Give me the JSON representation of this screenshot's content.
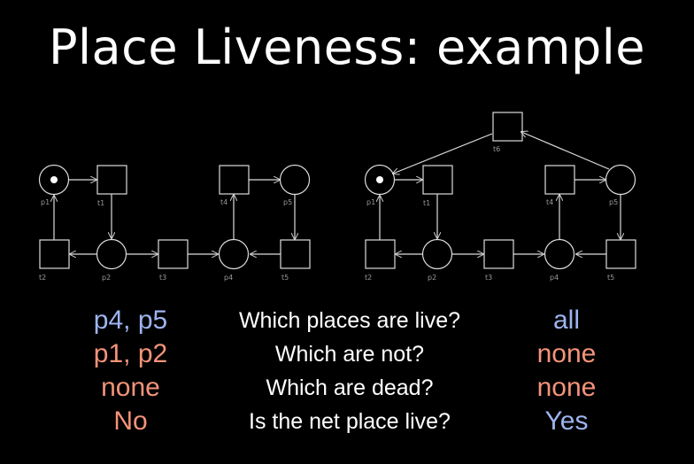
{
  "title": "Place Liveness: example",
  "net_labels": {
    "p1": "p1",
    "p2": "p2",
    "p4": "p4",
    "p5": "p5",
    "t1": "t1",
    "t2": "t2",
    "t3": "t3",
    "t4": "t4",
    "t5": "t5",
    "t6": "t6"
  },
  "left_answers": [
    "p4, p5",
    "p1, p2",
    "none",
    "No"
  ],
  "questions": [
    "Which places are live?",
    "Which are not?",
    "Which are dead?",
    "Is the net place live?"
  ],
  "right_answers": [
    "all",
    "none",
    "none",
    "Yes"
  ],
  "colors": {
    "blue": "#9db4ef",
    "orange": "#f4937a"
  }
}
